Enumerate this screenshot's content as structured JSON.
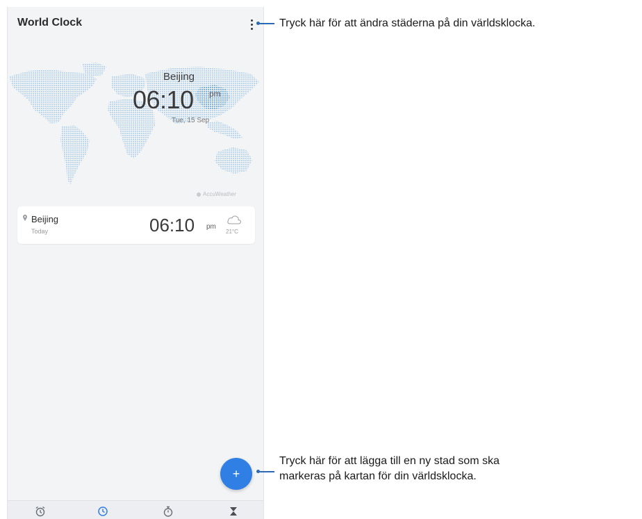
{
  "app": {
    "title": "World Clock"
  },
  "hero": {
    "city": "Beijing",
    "time": "06:10",
    "ampm": "pm",
    "date": "Tue, 15 Sep"
  },
  "attribution": "AccuWeather",
  "cities": [
    {
      "name": "Beijing",
      "day": "Today",
      "time": "06:10",
      "ampm": "pm",
      "temperature": "21°C",
      "weather_icon": "cloud-icon"
    }
  ],
  "fab": {
    "label": "+"
  },
  "bottom_nav": [
    {
      "icon": "alarm-clock-icon"
    },
    {
      "icon": "world-clock-icon",
      "active": true
    },
    {
      "icon": "stopwatch-icon"
    },
    {
      "icon": "hourglass-icon"
    }
  ],
  "callouts": {
    "menu": "Tryck här för att ändra städerna på din världsklocka.",
    "add_line1": "Tryck här för att lägga till en ny stad som ska",
    "add_line2": "markeras på kartan för din världsklocka."
  },
  "colors": {
    "accent": "#2f7fe5",
    "callout": "#2a6ab4",
    "map_dots": "#bcd6ef",
    "map_highlight": "#7fb0e3"
  }
}
